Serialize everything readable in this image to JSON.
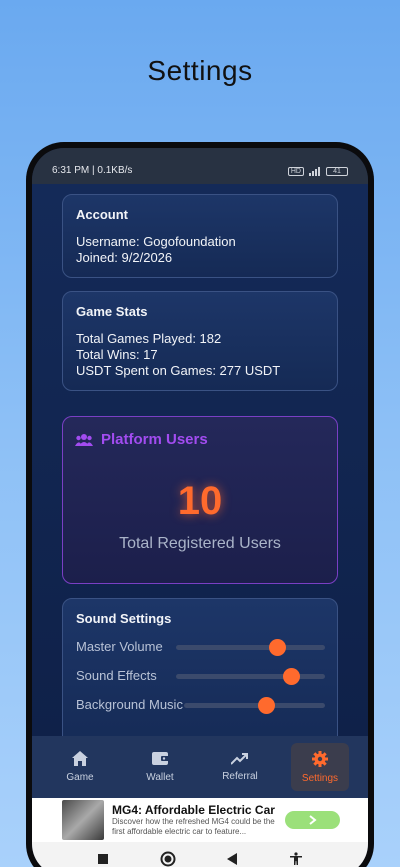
{
  "page_title": "Settings",
  "status": {
    "time": "6:31 PM | 0.1KB/s",
    "battery": "41"
  },
  "account": {
    "heading": "Account",
    "username": "Username: Gogofoundation",
    "joined": "Joined: 9/2/2026"
  },
  "game_stats": {
    "heading": "Game Stats",
    "total_games": "Total Games Played: 182",
    "total_wins": "Total Wins: 17",
    "usdt_spent": "USDT Spent on Games: 277 USDT"
  },
  "platform_users": {
    "heading": "Platform Users",
    "count": "10",
    "caption": "Total Registered Users"
  },
  "sound_settings": {
    "heading": "Sound Settings",
    "sliders": [
      {
        "label": "Master Volume",
        "value": 0.68
      },
      {
        "label": "Sound Effects",
        "value": 0.77
      },
      {
        "label": "Background Music",
        "value": 0.58
      }
    ]
  },
  "nav": [
    {
      "label": "Game",
      "icon": "home-icon",
      "active": false
    },
    {
      "label": "Wallet",
      "icon": "wallet-icon",
      "active": false
    },
    {
      "label": "Referral",
      "icon": "trending-up-icon",
      "active": false
    },
    {
      "label": "Settings",
      "icon": "gear-icon",
      "active": true
    }
  ],
  "ad": {
    "title": "MG4: Affordable Electric Car",
    "description": "Discover how the refreshed MG4 could be the first affordable electric car to feature..."
  },
  "colors": {
    "accent": "#ff6a2d",
    "purple": "#a24cf0"
  }
}
